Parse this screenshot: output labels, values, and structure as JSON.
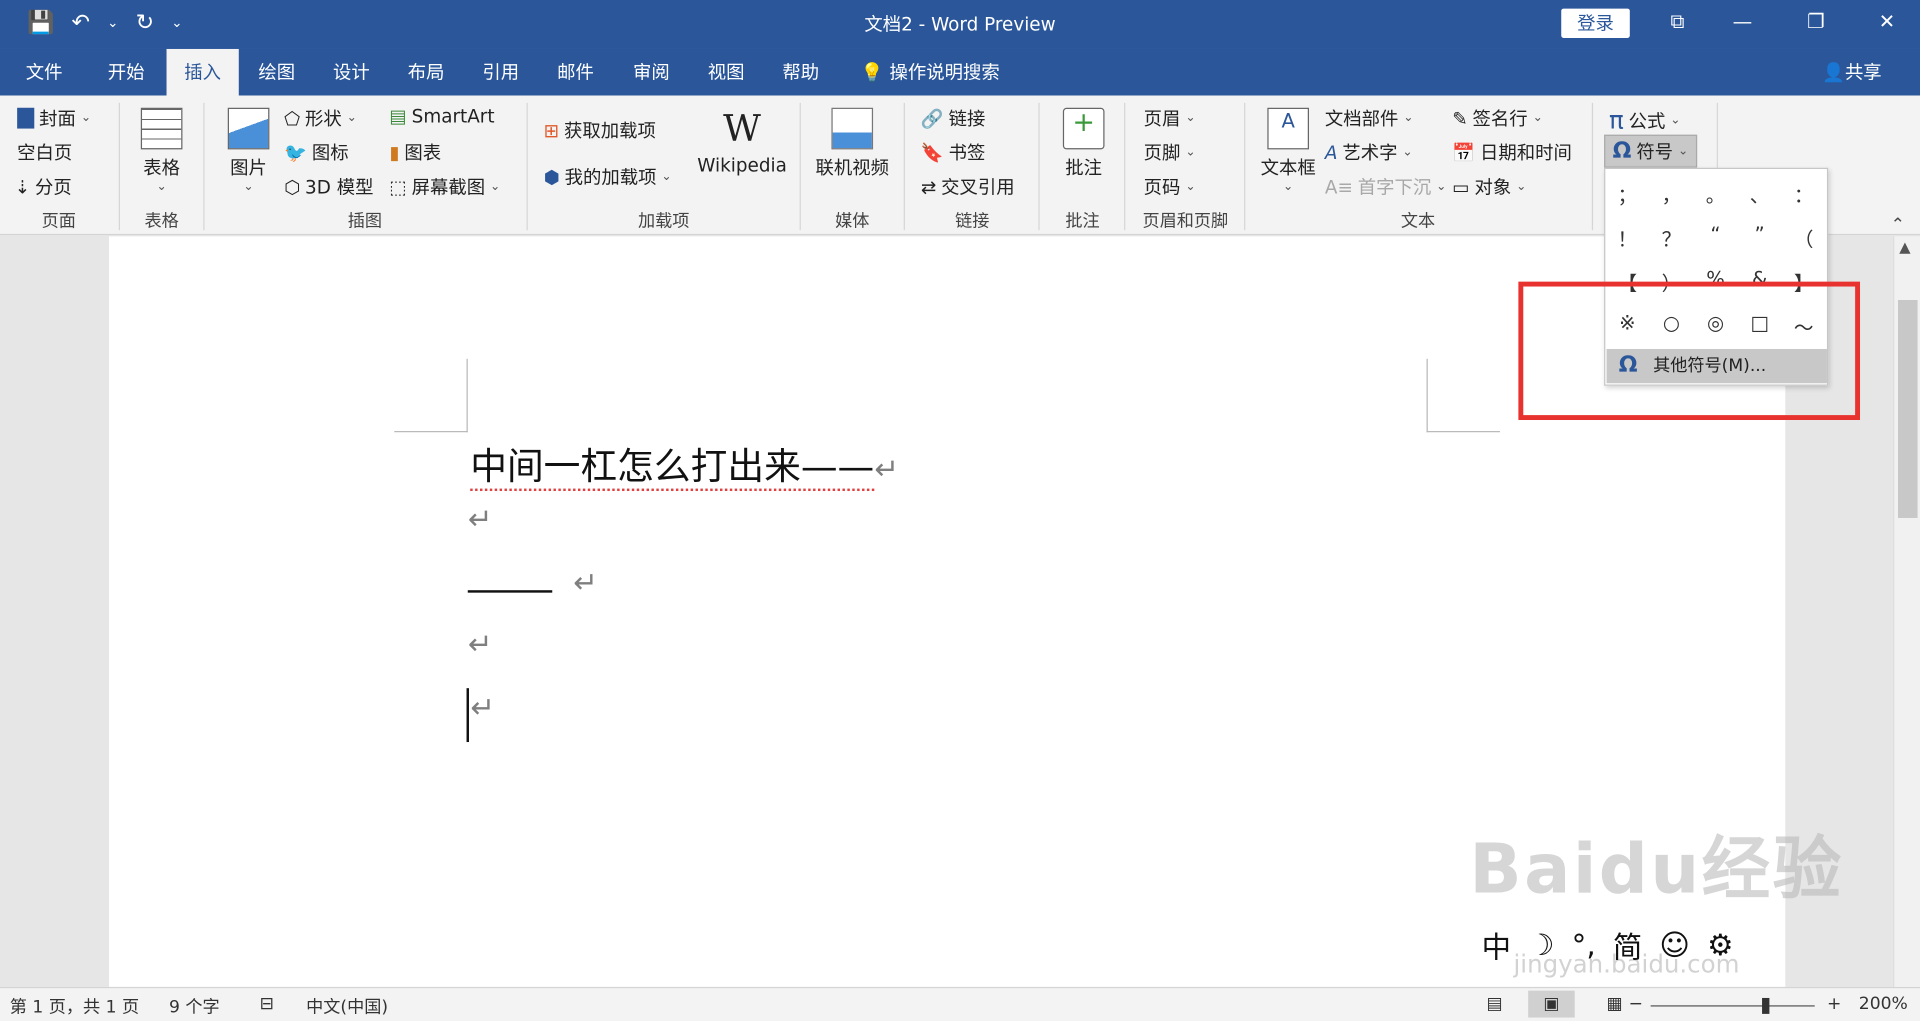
{
  "window": {
    "title": "文档2  -  Word Preview",
    "login_label": "登录"
  },
  "qat": {
    "save_icon": "save-icon",
    "undo_icon": "undo-icon",
    "redo_icon": "redo-icon"
  },
  "tabs": [
    {
      "label": "文件"
    },
    {
      "label": "开始"
    },
    {
      "label": "插入"
    },
    {
      "label": "绘图"
    },
    {
      "label": "设计"
    },
    {
      "label": "布局"
    },
    {
      "label": "引用"
    },
    {
      "label": "邮件"
    },
    {
      "label": "审阅"
    },
    {
      "label": "视图"
    },
    {
      "label": "帮助"
    }
  ],
  "active_tab": "插入",
  "search_label": "操作说明搜索",
  "share_label": "共享",
  "ribbon": {
    "pages": {
      "cover": "封面",
      "blank": "空白页",
      "break": "分页",
      "group": "页面"
    },
    "tables": {
      "table": "表格",
      "group": "表格"
    },
    "illustrations": {
      "picture": "图片",
      "shapes": "形状",
      "icons": "图标",
      "model3d": "3D 模型",
      "smartart": "SmartArt",
      "chart": "图表",
      "screenshot": "屏幕截图",
      "group": "插图"
    },
    "addins": {
      "get": "获取加载项",
      "mine": "我的加载项",
      "wikipedia": "Wikipedia",
      "group": "加载项"
    },
    "media": {
      "video": "联机视频",
      "group": "媒体"
    },
    "links": {
      "link": "链接",
      "bookmark": "书签",
      "xref": "交叉引用",
      "group": "链接"
    },
    "comments": {
      "comment": "批注",
      "group": "批注"
    },
    "headerfooter": {
      "header": "页眉",
      "footer": "页脚",
      "pagenum": "页码",
      "group": "页眉和页脚"
    },
    "text": {
      "textbox": "文本框",
      "quickparts": "文档部件",
      "wordart": "艺术字",
      "dropcap": "首字下沉",
      "signature": "签名行",
      "datetime": "日期和时间",
      "object": "对象",
      "group": "文本"
    },
    "symbols": {
      "equation": "公式",
      "symbol": "符号"
    }
  },
  "symbol_dropdown": {
    "rows": [
      [
        "；",
        "，",
        "。",
        "、",
        "："
      ],
      [
        "！",
        "？",
        "“",
        "”",
        "（"
      ],
      [
        "【",
        "）",
        "%",
        "&",
        "】"
      ],
      [
        "※",
        "○",
        "◎",
        "□",
        "～"
      ]
    ],
    "more_label": "其他符号(M)..."
  },
  "document": {
    "line1": "中间一杠怎么打出来——",
    "paragraph_mark": "↵"
  },
  "status": {
    "page": "第 1 页，共 1 页",
    "words": "9 个字",
    "language": "中文(中国)",
    "zoom": "200%"
  },
  "ime": {
    "items": [
      "中",
      "☽",
      "°,",
      "简",
      "☺",
      "⚙"
    ]
  },
  "watermark": {
    "text": "Baidu经验",
    "sub": "jingyan.baidu.com"
  }
}
